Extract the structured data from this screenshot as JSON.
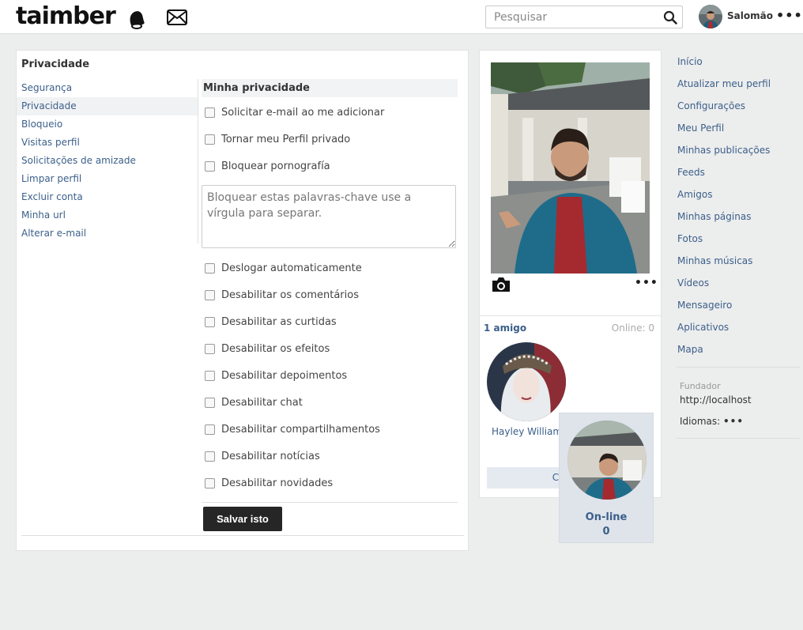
{
  "header": {
    "logo": "taimber",
    "search_placeholder": "Pesquisar",
    "user_name": "Salomão",
    "more": "•••"
  },
  "panel": {
    "title": "Privacidade",
    "nav": [
      {
        "label": "Segurança",
        "active": false
      },
      {
        "label": "Privacidade",
        "active": true
      },
      {
        "label": "Bloqueio",
        "active": false
      },
      {
        "label": "Visitas perfil",
        "active": false
      },
      {
        "label": "Solicitações de amizade",
        "active": false
      },
      {
        "label": "Limpar perfil",
        "active": false
      },
      {
        "label": "Excluir conta",
        "active": false
      },
      {
        "label": "Minha url",
        "active": false
      },
      {
        "label": "Alterar e-mail",
        "active": false
      }
    ],
    "section_title": "Minha privacidade",
    "options_top": [
      "Solicitar e-mail ao me adicionar",
      "Tornar meu Perfil privado",
      "Bloquear pornografía"
    ],
    "keywords_placeholder": "Bloquear estas palavras-chave use a vírgula para separar.",
    "options_bottom": [
      "Deslogar automaticamente",
      "Desabilitar os comentários",
      "Desabilitar as curtidas",
      "Desabilitar os efeitos",
      "Desabilitar depoimentos",
      "Desabilitar chat",
      "Desabilitar compartilhamentos",
      "Desabilitar notícias",
      "Desabilitar novidades"
    ],
    "save_label": "Salvar isto"
  },
  "card": {
    "more": "•••",
    "friends_count": "1 amigo",
    "online_count": "Online: 0",
    "friend_name": "Hayley Williams",
    "create_label": "Criar m"
  },
  "online_box": {
    "label": "On-line",
    "count": "0"
  },
  "right_menu": [
    "Início",
    "Atualizar meu perfil",
    "Configurações",
    "Meu Perfil",
    "Minhas publicações",
    "Feeds",
    "Amigos",
    "Minhas páginas",
    "Fotos",
    "Minhas músicas",
    "Vídeos",
    "Mensageiro",
    "Aplicativos",
    "Mapa"
  ],
  "footer": {
    "founder_label": "Fundador",
    "founder_url": "http://localhost",
    "languages_label": "Idiomas:",
    "languages_more": "•••"
  },
  "icons": {
    "bell": "bell-icon",
    "mail": "mail-icon",
    "search": "search-icon",
    "camera": "camera-icon"
  }
}
